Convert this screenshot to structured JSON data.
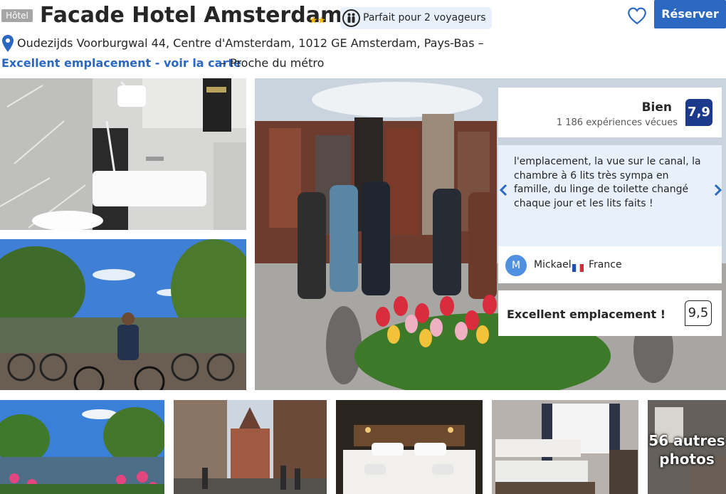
{
  "header": {
    "badge": "Hôtel",
    "title": "Facade Hotel Amsterdam",
    "stars": "★★",
    "suitable_label": "Parfait pour 2 voyageurs",
    "reserve_label": "Réserver"
  },
  "address": {
    "text": "Oudezijds Voorburgwal 44, Centre d'Amsterdam, 1012 GE Amsterdam, Pays-Bas –",
    "location_link": "Excellent emplacement - voir la carte",
    "metro": "– Proche du métro"
  },
  "review_summary": {
    "score_word": "Bien",
    "count_label": "1 186 expériences vécues",
    "score": "7,9"
  },
  "review_quote": {
    "text": "l'emplacement, la vue sur le canal, la chambre à 6 lits très sympa en famille, du linge de toilette changé chaque jour et les lits faits !",
    "avatar_letter": "M",
    "reviewer_name": "Mickael",
    "reviewer_country": "France"
  },
  "location_rating": {
    "label": "Excellent emplacement !",
    "score": "9,5"
  },
  "gallery": {
    "more_count": "56 autres",
    "more_word": "photos"
  },
  "colors": {
    "brand_blue": "#2b68c1",
    "score_navy": "#1b3a8c",
    "star_gold": "#f2b404",
    "quote_bg": "#e7f0fb"
  },
  "icons": [
    "people-icon",
    "heart-icon",
    "location-pin-icon",
    "chevron-left-icon",
    "chevron-right-icon",
    "france-flag-icon"
  ]
}
